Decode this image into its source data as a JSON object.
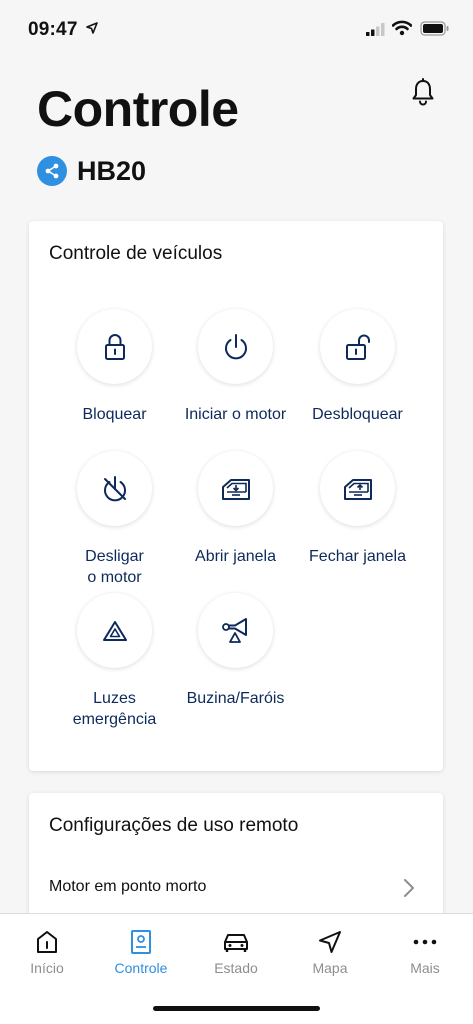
{
  "status_bar": {
    "time": "09:47"
  },
  "header": {
    "title": "Controle",
    "vehicle": "HB20"
  },
  "controls": {
    "title": "Controle de veículos",
    "lock": "Bloquear",
    "start": "Iniciar o motor",
    "unlock": "Desbloquear",
    "stop": "Desligar\no motor",
    "open_window": "Abrir janela",
    "close_window": "Fechar janela",
    "hazard": "Luzes\nemergência",
    "horn": "Buzina/Faróis"
  },
  "remote": {
    "title": "Configurações de uso remoto",
    "item": "Motor em ponto morto"
  },
  "tabs": {
    "home": "Início",
    "control": "Controle",
    "status": "Estado",
    "map": "Mapa",
    "more": "Mais"
  },
  "colors": {
    "accent": "#2f8fe0",
    "control_text": "#0d2a5a",
    "inactive_tab": "#8e8e8e"
  }
}
